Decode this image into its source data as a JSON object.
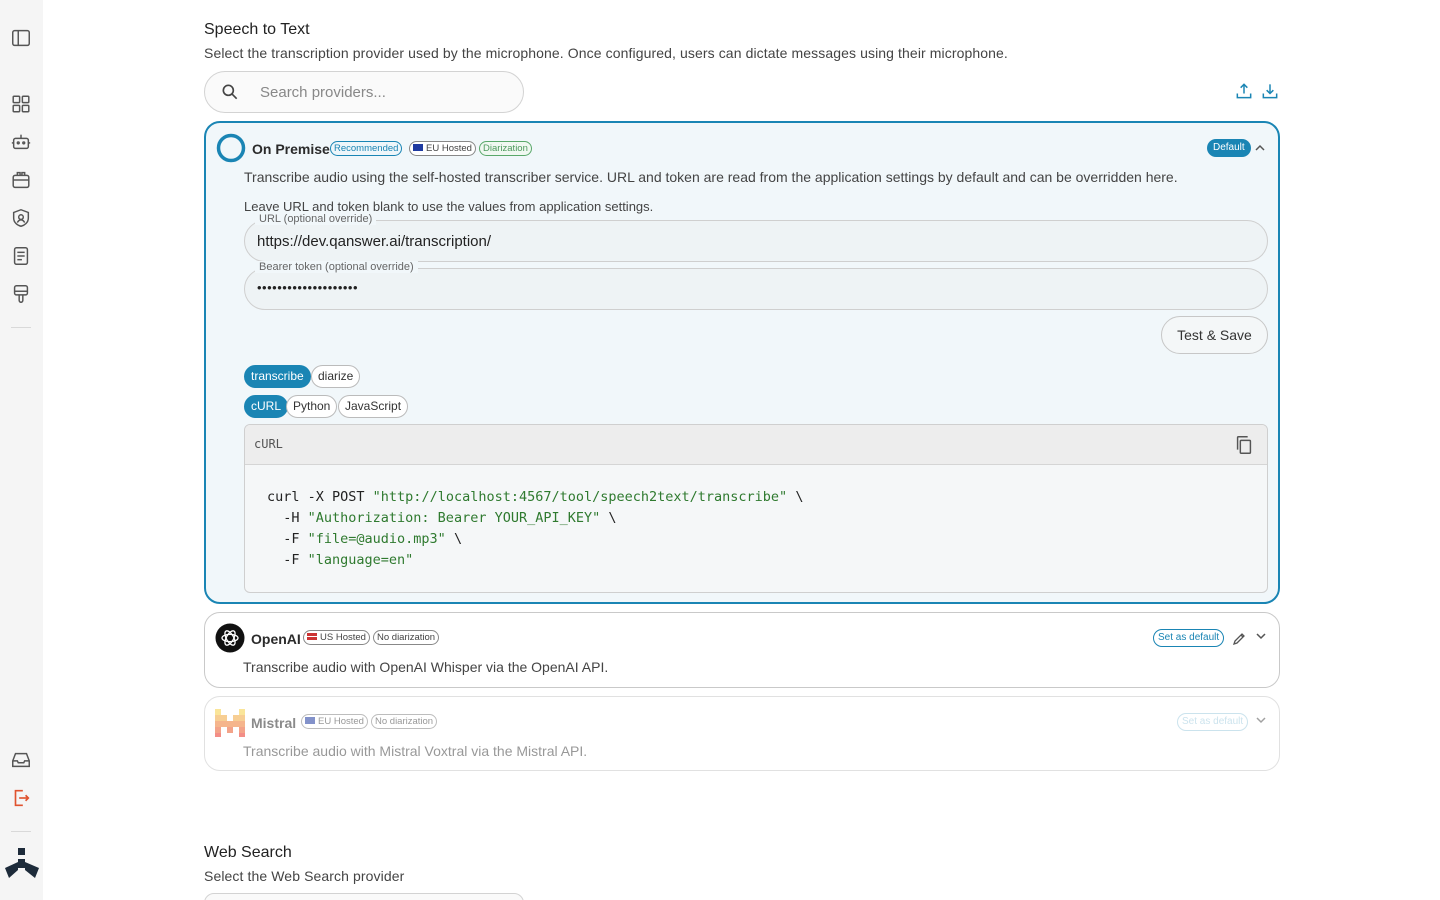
{
  "speech": {
    "title": "Speech to Text",
    "description": "Select the transcription provider used by the microphone. Once configured, users can dictate messages using their microphone.",
    "search_placeholder": "Search providers..."
  },
  "providers": [
    {
      "name": "On Premise",
      "chips": [
        "Recommended",
        "EU Hosted",
        "Diarization"
      ],
      "description": "Transcribe audio using the self-hosted transcriber service. URL and token are read from the application settings by default and can be overridden here.",
      "badge": "Default",
      "note": "Leave URL and token blank to use the values from application settings.",
      "url_label": "URL (optional override)",
      "url_value": "https://dev.qanswer.ai/transcription/",
      "token_label": "Bearer token (optional override)",
      "token_value": "••••••••••••••••••••",
      "save_label": "Test & Save",
      "endpoint_tabs": [
        "transcribe",
        "diarize"
      ],
      "lang_tabs": [
        "cURL",
        "Python",
        "JavaScript"
      ],
      "code_lang": "cURL",
      "code": {
        "l1_cmd": "curl -X POST ",
        "l1_str": "\"http://localhost:4567/tool/speech2text/transcribe\"",
        "l1_end": " \\",
        "l2_cmd": "  -H ",
        "l2_str": "\"Authorization: Bearer YOUR_API_KEY\"",
        "l2_end": " \\",
        "l3_cmd": "  -F ",
        "l3_str": "\"file=@audio.mp3\"",
        "l3_end": " \\",
        "l4_cmd": "  -F ",
        "l4_str": "\"language=en\""
      }
    },
    {
      "name": "OpenAI",
      "chips": [
        "US Hosted",
        "No diarization"
      ],
      "description": "Transcribe audio with OpenAI Whisper via the OpenAI API.",
      "badge": "Set as default"
    },
    {
      "name": "Mistral",
      "chips": [
        "EU Hosted",
        "No diarization"
      ],
      "description": "Transcribe audio with Mistral Voxtral via the Mistral API.",
      "badge": "Set as default"
    }
  ],
  "web_search": {
    "title": "Web Search",
    "description": "Select the Web Search provider"
  },
  "colors": {
    "accent": "#1a85b4",
    "sidebar": "#f5f5f5",
    "logout": "#e0532f"
  }
}
